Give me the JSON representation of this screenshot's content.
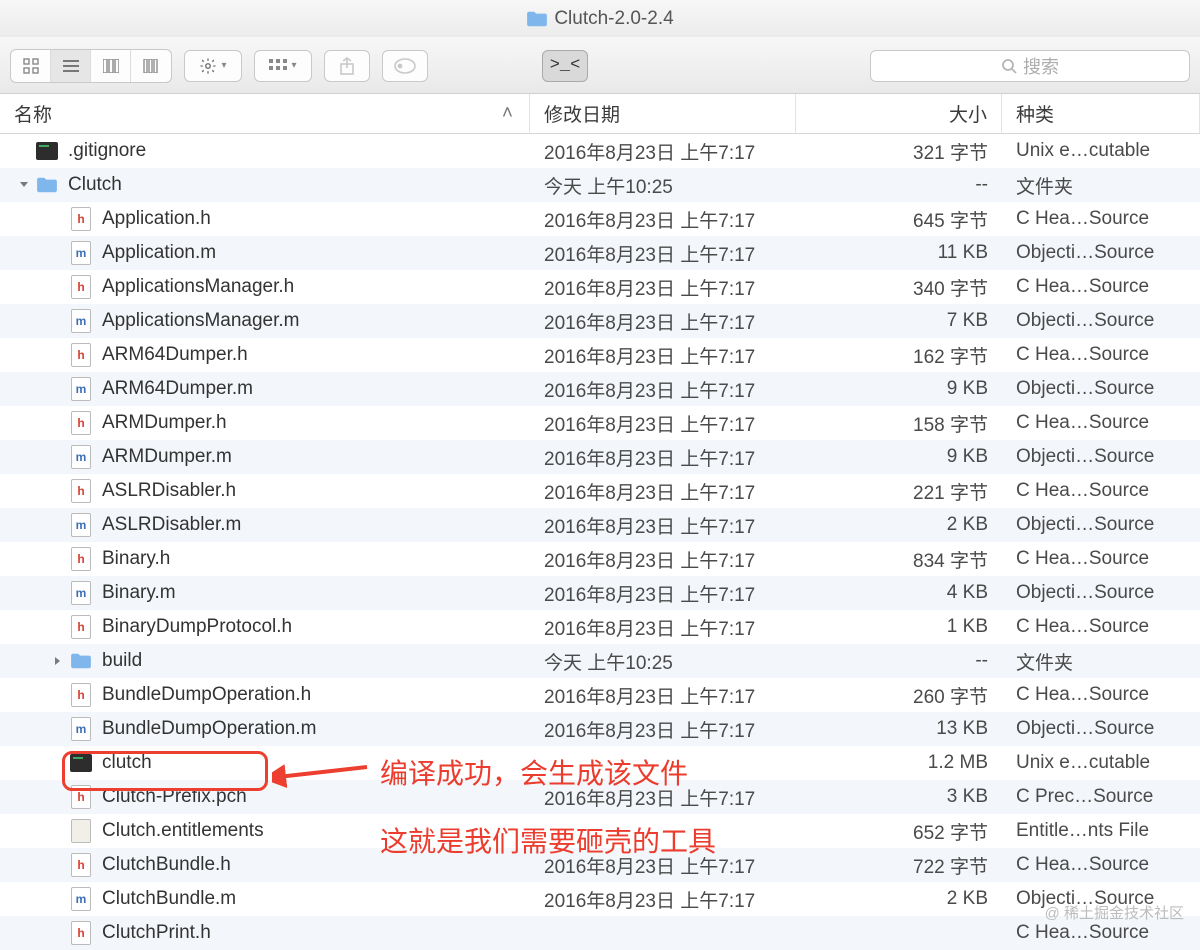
{
  "window": {
    "title": "Clutch-2.0-2.4"
  },
  "search": {
    "placeholder": "搜索"
  },
  "columns": {
    "name": "名称",
    "date": "修改日期",
    "size": "大小",
    "kind": "种类"
  },
  "annotation": {
    "line1": "编译成功，会生成该文件",
    "line2": "这就是我们需要砸壳的工具"
  },
  "watermark": "@ 稀土掘金技术社区",
  "files": [
    {
      "indent": 0,
      "icon": "exec",
      "name": ".gitignore",
      "date": "2016年8月23日 上午7:17",
      "size": "321 字节",
      "kind": "Unix e…cutable",
      "disclosure": ""
    },
    {
      "indent": 0,
      "icon": "folder",
      "name": "Clutch",
      "date": "今天 上午10:25",
      "size": "--",
      "kind": "文件夹",
      "disclosure": "open"
    },
    {
      "indent": 1,
      "icon": "h",
      "name": "Application.h",
      "date": "2016年8月23日 上午7:17",
      "size": "645 字节",
      "kind": "C Hea…Source"
    },
    {
      "indent": 1,
      "icon": "m",
      "name": "Application.m",
      "date": "2016年8月23日 上午7:17",
      "size": "11 KB",
      "kind": "Objecti…Source"
    },
    {
      "indent": 1,
      "icon": "h",
      "name": "ApplicationsManager.h",
      "date": "2016年8月23日 上午7:17",
      "size": "340 字节",
      "kind": "C Hea…Source"
    },
    {
      "indent": 1,
      "icon": "m",
      "name": "ApplicationsManager.m",
      "date": "2016年8月23日 上午7:17",
      "size": "7 KB",
      "kind": "Objecti…Source"
    },
    {
      "indent": 1,
      "icon": "h",
      "name": "ARM64Dumper.h",
      "date": "2016年8月23日 上午7:17",
      "size": "162 字节",
      "kind": "C Hea…Source"
    },
    {
      "indent": 1,
      "icon": "m",
      "name": "ARM64Dumper.m",
      "date": "2016年8月23日 上午7:17",
      "size": "9 KB",
      "kind": "Objecti…Source"
    },
    {
      "indent": 1,
      "icon": "h",
      "name": "ARMDumper.h",
      "date": "2016年8月23日 上午7:17",
      "size": "158 字节",
      "kind": "C Hea…Source"
    },
    {
      "indent": 1,
      "icon": "m",
      "name": "ARMDumper.m",
      "date": "2016年8月23日 上午7:17",
      "size": "9 KB",
      "kind": "Objecti…Source"
    },
    {
      "indent": 1,
      "icon": "h",
      "name": "ASLRDisabler.h",
      "date": "2016年8月23日 上午7:17",
      "size": "221 字节",
      "kind": "C Hea…Source"
    },
    {
      "indent": 1,
      "icon": "m",
      "name": "ASLRDisabler.m",
      "date": "2016年8月23日 上午7:17",
      "size": "2 KB",
      "kind": "Objecti…Source"
    },
    {
      "indent": 1,
      "icon": "h",
      "name": "Binary.h",
      "date": "2016年8月23日 上午7:17",
      "size": "834 字节",
      "kind": "C Hea…Source"
    },
    {
      "indent": 1,
      "icon": "m",
      "name": "Binary.m",
      "date": "2016年8月23日 上午7:17",
      "size": "4 KB",
      "kind": "Objecti…Source"
    },
    {
      "indent": 1,
      "icon": "h",
      "name": "BinaryDumpProtocol.h",
      "date": "2016年8月23日 上午7:17",
      "size": "1 KB",
      "kind": "C Hea…Source"
    },
    {
      "indent": 1,
      "icon": "folder",
      "name": "build",
      "date": "今天 上午10:25",
      "size": "--",
      "kind": "文件夹",
      "disclosure": "closed"
    },
    {
      "indent": 1,
      "icon": "h",
      "name": "BundleDumpOperation.h",
      "date": "2016年8月23日 上午7:17",
      "size": "260 字节",
      "kind": "C Hea…Source"
    },
    {
      "indent": 1,
      "icon": "m",
      "name": "BundleDumpOperation.m",
      "date": "2016年8月23日 上午7:17",
      "size": "13 KB",
      "kind": "Objecti…Source"
    },
    {
      "indent": 1,
      "icon": "exec",
      "name": "clutch",
      "date": "",
      "size": "1.2 MB",
      "kind": "Unix e…cutable",
      "highlight": true
    },
    {
      "indent": 1,
      "icon": "h",
      "name": "Clutch-Prefix.pch",
      "date": "2016年8月23日 上午7:17",
      "size": "3 KB",
      "kind": "C Prec…Source"
    },
    {
      "indent": 1,
      "icon": "ent",
      "name": "Clutch.entitlements",
      "date": "",
      "size": "652 字节",
      "kind": "Entitle…nts File"
    },
    {
      "indent": 1,
      "icon": "h",
      "name": "ClutchBundle.h",
      "date": "2016年8月23日 上午7:17",
      "size": "722 字节",
      "kind": "C Hea…Source"
    },
    {
      "indent": 1,
      "icon": "m",
      "name": "ClutchBundle.m",
      "date": "2016年8月23日 上午7:17",
      "size": "2 KB",
      "kind": "Objecti…Source"
    },
    {
      "indent": 1,
      "icon": "h",
      "name": "ClutchPrint.h",
      "date": "",
      "size": "",
      "kind": "C Hea…Source"
    }
  ]
}
